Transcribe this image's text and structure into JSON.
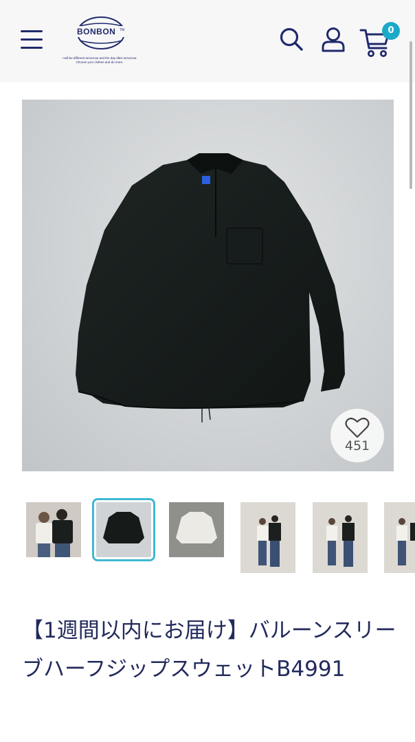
{
  "header": {
    "brand_name": "BONBON",
    "brand_tm": "TM",
    "tagline_1": "I will be different tomorrow and the day after tomorrow.",
    "tagline_2": "Choose your clothes and do more.",
    "cart_count": "0",
    "icons": [
      "menu-icon",
      "search-icon",
      "user-icon",
      "cart-icon"
    ],
    "accent_color": "#1ba9c8",
    "brand_color": "#1f2a6b"
  },
  "product": {
    "favorite_count": "451",
    "title": "【1週間以内にお届け】バルーンスリーブハーフジップスウェットB4991",
    "selected_thumbnail": 2,
    "thumbnails": [
      "couple-front",
      "black-sweat",
      "white-sweat",
      "couple-full-1",
      "couple-full-2",
      "couple-full-3"
    ]
  }
}
